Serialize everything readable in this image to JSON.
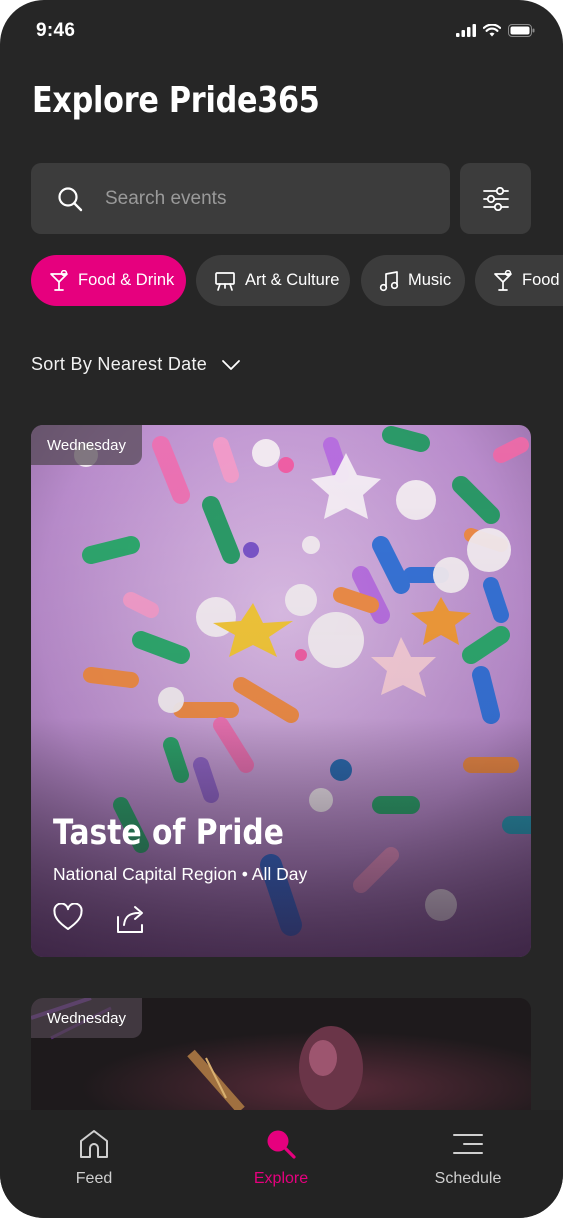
{
  "status_bar": {
    "time": "9:46"
  },
  "header": {
    "title": "Explore Pride365"
  },
  "search": {
    "placeholder": "Search events"
  },
  "categories": [
    {
      "label": "Food & Drink",
      "active": true
    },
    {
      "label": "Art & Culture",
      "active": false
    },
    {
      "label": "Music",
      "active": false
    },
    {
      "label": "Food",
      "active": false
    }
  ],
  "sort": {
    "label": "Sort By Nearest Date"
  },
  "events": [
    {
      "day": "Wednesday",
      "title": "Taste of Pride",
      "region": "National Capital Region",
      "time": "All Day"
    },
    {
      "day": "Wednesday"
    }
  ],
  "tabs": [
    {
      "label": "Feed",
      "icon": "home-icon",
      "active": false
    },
    {
      "label": "Explore",
      "icon": "search-icon",
      "active": true
    },
    {
      "label": "Schedule",
      "icon": "menu-lines-icon",
      "active": false
    }
  ],
  "colors": {
    "accent": "#e6007e",
    "background": "#262626",
    "surface": "#3c3c3c"
  }
}
